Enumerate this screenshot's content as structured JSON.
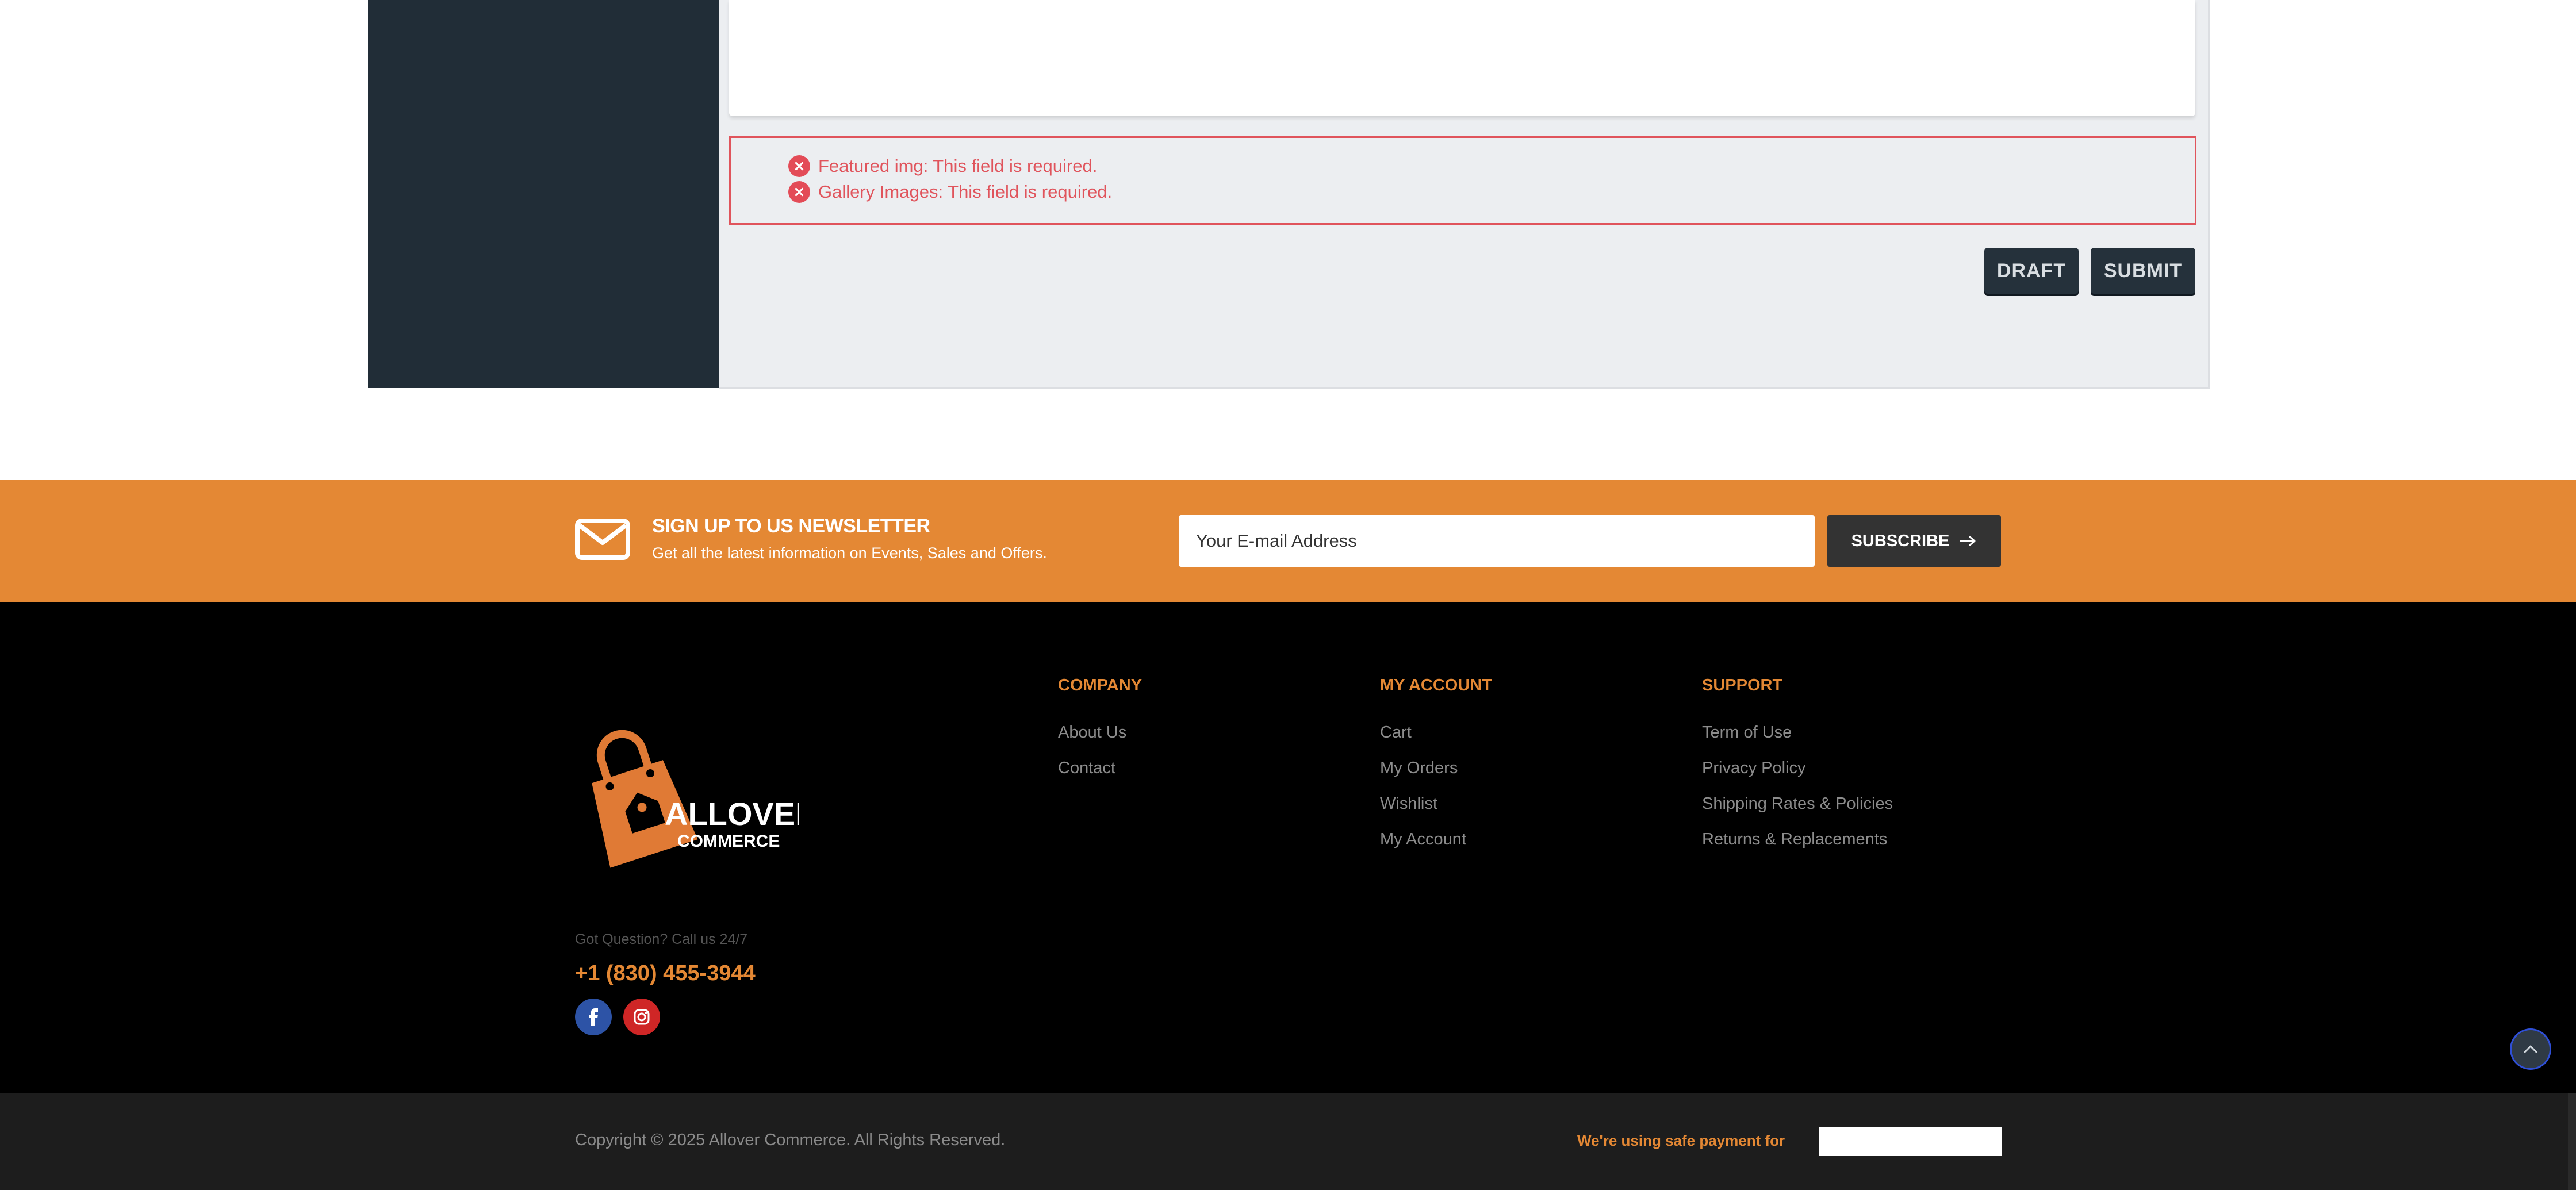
{
  "form": {
    "errors": [
      "Featured img: This field is required.",
      "Gallery Images: This field is required."
    ],
    "draft_label": "DRAFT",
    "submit_label": "SUBMIT"
  },
  "newsletter": {
    "title": "SIGN UP TO US NEWSLETTER",
    "subtitle": "Get all the latest information on Events, Sales and Offers.",
    "email_placeholder": "Your E-mail Address",
    "subscribe_label": "SUBSCRIBE",
    "background_color": "#e48834"
  },
  "footer": {
    "logo": {
      "word1": "ALLOVER",
      "word2": "COMMERCE"
    },
    "call_label": "Got Question? Call us 24/7",
    "phone": "+1 (830) 455-3944",
    "columns": [
      {
        "heading": "COMPANY",
        "links": [
          "About Us",
          "Contact"
        ]
      },
      {
        "heading": "MY ACCOUNT",
        "links": [
          "Cart",
          "My Orders",
          "Wishlist",
          "My Account"
        ]
      },
      {
        "heading": "SUPPORT",
        "links": [
          "Term of Use",
          "Privacy Policy",
          "Shipping Rates & Policies",
          "Returns & Replacements"
        ]
      }
    ],
    "social_icons": [
      "facebook-icon",
      "instagram-icon"
    ],
    "copyright": "Copyright © 2025 Allover Commerce. All Rights Reserved.",
    "safe_payment": "We're using safe payment for",
    "accent_color": "#e48834"
  }
}
